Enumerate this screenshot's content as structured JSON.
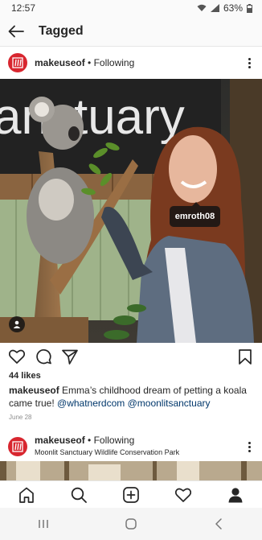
{
  "status_bar": {
    "time": "12:57",
    "battery": "63%"
  },
  "appbar": {
    "title": "Tagged",
    "back_icon": "arrow-left-icon"
  },
  "post": {
    "username": "makeuseof",
    "following": " • Following",
    "tag_label": "emroth08",
    "likes": "44 likes",
    "caption_user": "makeuseof",
    "caption_text": " Emma’s childhood dream of petting a koala came true! ",
    "mention1": "@whatnerdcom",
    "mention2": "@moonlitsanctuary",
    "date": "June 28",
    "photo_sign_text": "anctuary"
  },
  "post2": {
    "username": "makeuseof",
    "following": " • Following",
    "location": "Moonlit Sanctuary Wildlife Conservation Park"
  },
  "colors": {
    "brand_red": "#d8262f",
    "mention_blue": "#00376b",
    "muted_gray": "#8e8e8e"
  },
  "icons": {
    "like": "heart-icon",
    "comment": "comment-icon",
    "share": "send-icon",
    "save": "bookmark-icon",
    "nav": [
      "home-icon",
      "search-icon",
      "new-post-icon",
      "activity-icon",
      "profile-icon"
    ],
    "system": [
      "recents-icon",
      "home-circle-icon",
      "back-chevron-icon"
    ]
  }
}
